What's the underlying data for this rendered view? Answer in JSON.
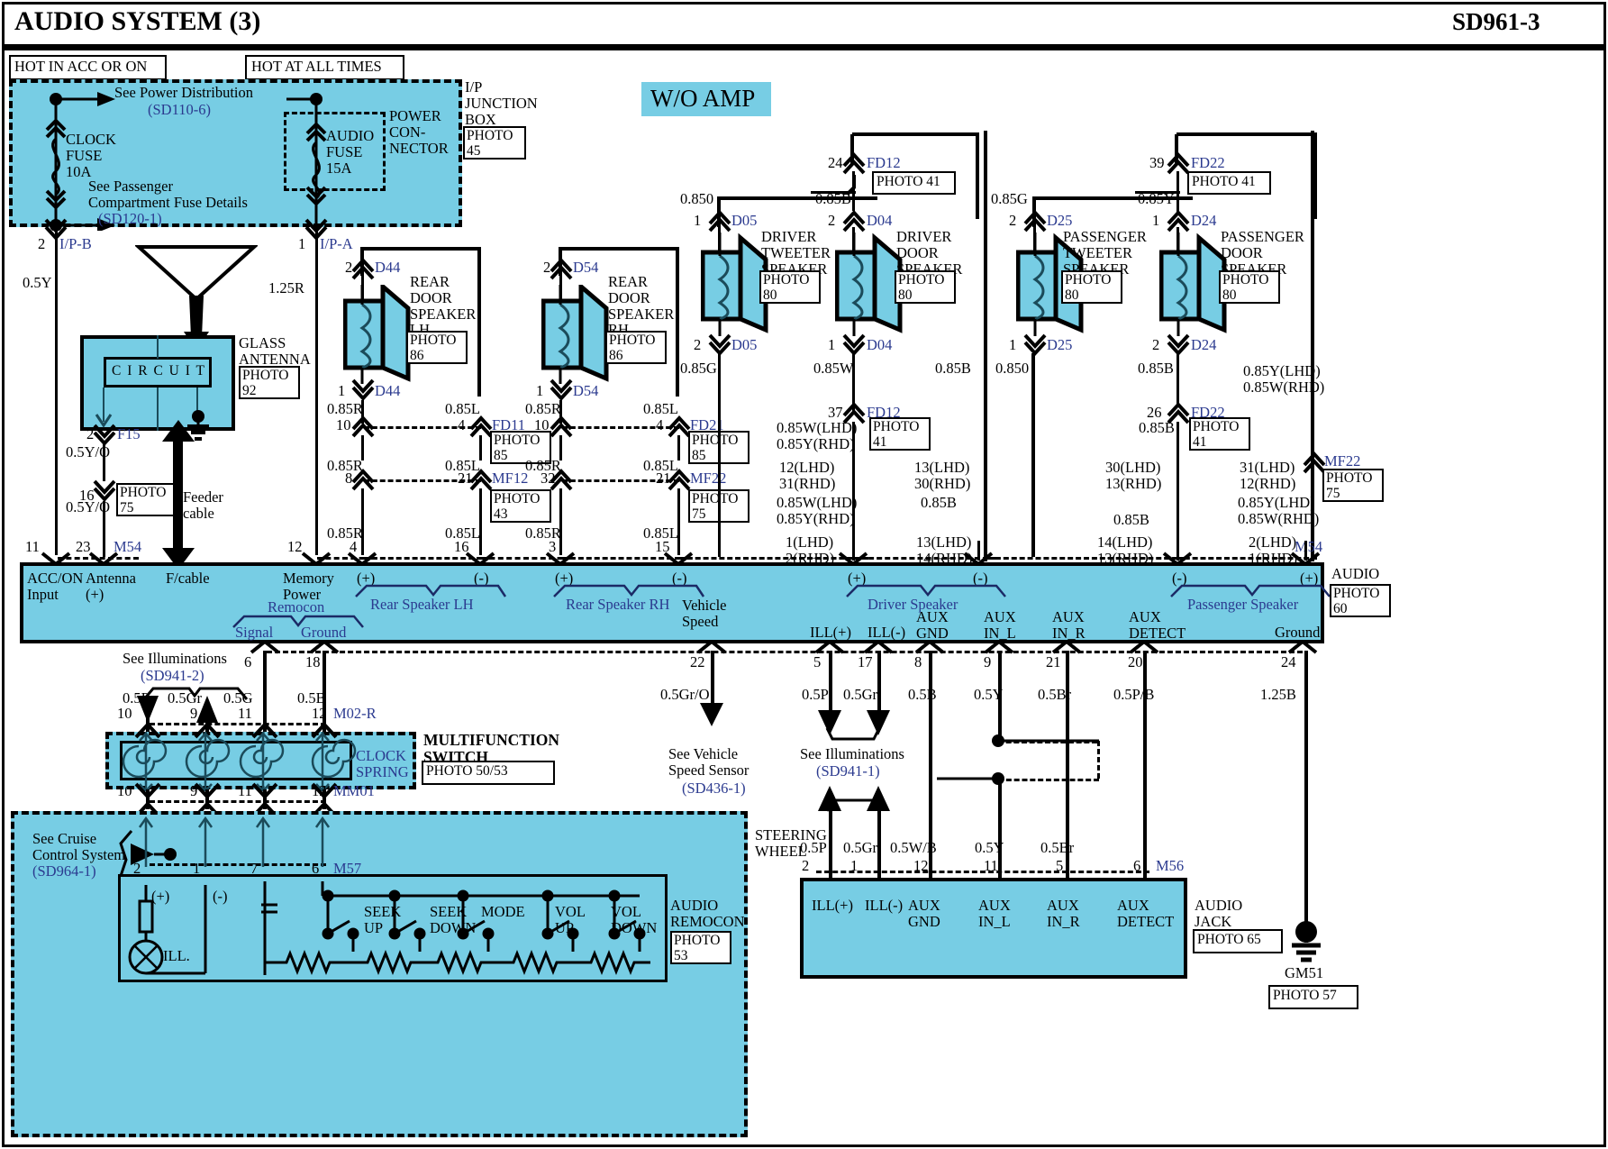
{
  "header": {
    "title": "AUDIO SYSTEM (3)",
    "code": "SD961-3"
  },
  "labels": {
    "hot_acc": "HOT IN ACC OR ON",
    "hot_all": "HOT AT ALL TIMES",
    "see_power_dist": "See Power Distribution",
    "see_power_dist_ref": "(SD110-6)",
    "clock_fuse": "CLOCK\nFUSE\n10A",
    "see_pass_fuse": "See Passenger\nCompartment Fuse Details",
    "see_pass_fuse_ref": "(SD120-1)",
    "audio_fuse": "AUDIO\nFUSE\n15A",
    "power_connector": "POWER\nCON-\nNECTOR",
    "ip_junction_box": "I/P\nJUNCTION\nBOX",
    "ip_junction_photo": "PHOTO\n45",
    "wo_amp": "W/O AMP",
    "glass_antenna": "GLASS\nANTENNA",
    "glass_antenna_photo": "PHOTO\n92",
    "circuit": "C I R C U I T",
    "feeder_cable": "Feeder\ncable",
    "see_illum_2": "See Illuminations",
    "see_illum_2_ref": "(SD941-2)",
    "see_illum_1": "See Illuminations",
    "see_illum_1_ref": "(SD941-1)",
    "see_vehicle_speed": "See Vehicle\nSpeed Sensor",
    "see_vehicle_speed_ref": "(SD436-1)",
    "see_cruise": "See Cruise\nControl System",
    "see_cruise_ref": "(SD964-1)",
    "multifunction_switch": "MULTIFUNCTION\nSWITCH",
    "multifunction_photo": "PHOTO 50/53",
    "clock_spring": "CLOCK\nSPRING",
    "steering_wheel": "STEERING\nWHEEL",
    "audio_remocon_switch": "AUDIO\nREMOCON\nSWITCH",
    "audio_remocon_photo": "PHOTO\n53",
    "audio_jack": "AUDIO\nJACK",
    "audio_jack_photo": "PHOTO 65",
    "audio": "AUDIO",
    "audio_photo": "PHOTO\n60",
    "ill": "ILL.",
    "gm51": "GM51",
    "gm51_photo": "PHOTO 57"
  },
  "speakers": [
    {
      "name": "REAR\nDOOR\nSPEAKER\nLH",
      "photo": "PHOTO\n86",
      "top_pin": "2",
      "top_conn": "D44",
      "bot_pin": "1",
      "bot_conn": "D44"
    },
    {
      "name": "REAR\nDOOR\nSPEAKER\nRH",
      "photo": "PHOTO\n86",
      "top_pin": "2",
      "top_conn": "D54",
      "bot_pin": "1",
      "bot_conn": "D54"
    },
    {
      "name": "DRIVER\nTWEETER\nSPEAKER",
      "photo": "PHOTO\n80",
      "top_pin": "1",
      "top_conn": "D05",
      "bot_pin": "2",
      "bot_conn": "D05"
    },
    {
      "name": "DRIVER\nDOOR\nSPEAKER",
      "photo": "PHOTO\n80",
      "top_pin": "2",
      "top_conn": "D04",
      "bot_pin": "1",
      "bot_conn": "D04"
    },
    {
      "name": "PASSENGER\nTWEETER\nSPEAKER",
      "photo": "PHOTO\n80",
      "top_pin": "2",
      "top_conn": "D25",
      "bot_pin": "1",
      "bot_conn": "D25"
    },
    {
      "name": "PASSENGER\nDOOR\nSPEAKER",
      "photo": "PHOTO\n80",
      "top_pin": "1",
      "top_conn": "D24",
      "bot_pin": "2",
      "bot_conn": "D24"
    }
  ],
  "connectors": {
    "fd12_top": {
      "pin": "24",
      "name": "FD12",
      "photo": "PHOTO 41"
    },
    "fd22_top": {
      "pin": "39",
      "name": "FD22",
      "photo": "PHOTO 41"
    },
    "fd12_bot": {
      "pin": "37",
      "name": "FD12",
      "photo": "PHOTO\n41"
    },
    "fd22_bot": {
      "pin": "26",
      "name": "FD22",
      "photo": "PHOTO\n41"
    },
    "fd11": {
      "pin_l": "10",
      "pin_r": "4",
      "name": "FD11",
      "photo": "PHOTO\n85"
    },
    "fd21": {
      "pin_l": "10",
      "pin_r": "4",
      "name": "FD21",
      "photo": "PHOTO\n85"
    },
    "mf12": {
      "pin_l": "8",
      "pin_r": "21",
      "name": "MF12",
      "pin_r2": "32",
      "photo": "PHOTO\n43"
    },
    "mf22_rear": {
      "pin_l": "",
      "pin_r": "21",
      "name": "MF22",
      "photo": "PHOTO\n75"
    },
    "mf22_ant": {
      "pin": "16",
      "name": "MF22",
      "photo": "PHOTO\n75"
    },
    "mf22_right": {
      "name": "MF22",
      "photo": "PHOTO\n75"
    },
    "ipb": {
      "pin": "2",
      "name": "I/P-B"
    },
    "ipa": {
      "pin": "1",
      "name": "I/P-A"
    },
    "f15": {
      "pin": "2",
      "name": "F15"
    },
    "m54": {
      "name": "M54"
    },
    "m02r": {
      "name": "M02-R"
    },
    "mm01": {
      "name": "MM01"
    },
    "m57": {
      "name": "M57"
    },
    "m56": {
      "name": "M56"
    }
  },
  "wire_labels": {
    "ipb_wire": "0.5Y",
    "ipa_wire": "1.25R",
    "f15_wire": "0.5Y/O",
    "mf22_ant_wire": "0.5Y/O",
    "d44_out": "0.85R",
    "fd11_out": "0.85L",
    "d54_out": "0.85R",
    "fd21_out": "0.85L",
    "mf12_l": "0.85R",
    "mf12_r": "0.85L",
    "mf12_l2": "0.85R",
    "mf12_r2": "0.85L",
    "bot_r_lh": "0.85R",
    "bot_l_lh": "0.85L",
    "bot_r_rh": "0.85R",
    "bot_l_rh": "0.85L",
    "d05_in": "0.850",
    "d04_in": "0.85B",
    "d25_in": "0.85G",
    "d24_in": "0.85Y",
    "d05_out": "0.85G",
    "d04_out": "0.85W",
    "d25_out": "0.850",
    "d24_out": "0.85B",
    "drv_mid": "0.85B",
    "psg_mid": "0.85B",
    "psg_lhd_rhd": "0.85Y(LHD)\n0.85W(RHD)",
    "drv_lhd_rhd_1": "0.85W(LHD)\n0.85Y(RHD)",
    "drv_lhd_rhd_2": "0.85W(LHD)\n0.85Y(RHD)",
    "drv_b": "0.85B",
    "psg_b": "0.85B",
    "psg_lhd_rhd_2": "0.85Y(LHD)\n0.85W(RHD)",
    "psg_b2": "0.85B",
    "vspeed": "0.5Gr/O",
    "ill_p": "0.5P",
    "ill_gr": "0.5Gr",
    "aux_gnd": "0.5B",
    "aux_in_l": "0.5Y",
    "aux_in_r": "0.5Br",
    "aux_detect": "0.5P/B",
    "gnd_125b": "1.25B",
    "ms_p": "0.5P",
    "ms_gr": "0.5Gr",
    "ms_g": "0.5G",
    "ms_b": "0.5B",
    "jack_p": "0.5P",
    "jack_gr": "0.5Gr",
    "jack_wb": "0.5W/B",
    "jack_y": "0.5Y",
    "jack_br": "0.5Br"
  },
  "pin_numbers": {
    "drv_tweeter_group": "12(LHD)\n31(RHD)",
    "drv_door_group": "13(LHD)\n30(RHD)",
    "psg_tweeter_group": "30(LHD)\n13(RHD)",
    "psg_door_group": "31(LHD)\n12(RHD)",
    "drv_bot_1": "1(LHD)\n2(RHD)",
    "drv_bot_2": "13(LHD)\n14(RHD)",
    "psg_bot_1": "14(LHD)\n13(RHD)",
    "psg_bot_2": "2(LHD)\n1(RHD)",
    "drv_w_label": "0.85W(LHD)\n0.85Y(RHD)",
    "main_11": "11",
    "main_23": "23",
    "main_12": "12",
    "main_4": "4",
    "main_16": "16",
    "main_3": "3",
    "main_15": "15",
    "main_6": "6",
    "main_18": "18",
    "main_22": "22",
    "main_5": "5",
    "main_17": "17",
    "main_8": "8",
    "main_9": "9",
    "main_21": "21",
    "main_20": "20",
    "main_24": "24"
  },
  "main_connector": {
    "pins_top": [
      {
        "num": "11",
        "label": "ACC/ON\nInput"
      },
      {
        "num": "23",
        "label": "Antenna\n(+)"
      },
      {
        "num": "",
        "label": "F/cable"
      },
      {
        "num": "12",
        "label": "Memory\nPower"
      },
      {
        "num": "4",
        "label": "(+)"
      },
      {
        "num": "16",
        "label": "(-)"
      },
      {
        "num": "3",
        "label": "(+)"
      },
      {
        "num": "15",
        "label": "(-)"
      },
      {
        "num": "",
        "label": "(+)"
      },
      {
        "num": "",
        "label": "(-)"
      },
      {
        "num": "",
        "label": "(-)"
      },
      {
        "num": "",
        "label": "(+)"
      }
    ],
    "groups": [
      "Remocon",
      "Rear Speaker LH",
      "Rear Speaker RH",
      "Driver Speaker",
      "Passenger Speaker"
    ],
    "sub_labels": [
      "Signal",
      "Ground"
    ],
    "bottom_labels": [
      "Vehicle\nSpeed",
      "ILL(+)",
      "ILL(-)",
      "AUX\nGND",
      "AUX\nIN_L",
      "AUX\nIN_R",
      "AUX\nDETECT",
      "Ground"
    ],
    "bottom_pins": [
      "6",
      "18",
      "22",
      "5",
      "17",
      "8",
      "9",
      "21",
      "20",
      "24"
    ]
  },
  "remocon_switch": {
    "buttons": [
      "SEEK\nUP",
      "SEEK\nDOWN",
      "MODE",
      "VOL\nUP",
      "VOL\nDOWN"
    ],
    "plus": "(+)",
    "minus": "(-)",
    "pins": [
      "2",
      "1",
      "7",
      "6"
    ]
  },
  "clock_spring": {
    "top_pins": [
      "10",
      "9",
      "11",
      "12"
    ],
    "bottom_pins": [
      "10",
      "9",
      "11",
      "12"
    ]
  },
  "aux_jack": {
    "labels": [
      "ILL(+)",
      "ILL(-)",
      "AUX\nGND",
      "AUX\nIN_L",
      "AUX\nIN_R",
      "AUX\nDETECT"
    ],
    "pins": [
      "2",
      "1",
      "12",
      "11",
      "5",
      "6"
    ]
  },
  "colors": {
    "cyan": "#77cde4",
    "blue_text": "#2b3a8f",
    "line": "#000000",
    "background": "#ffffff"
  }
}
